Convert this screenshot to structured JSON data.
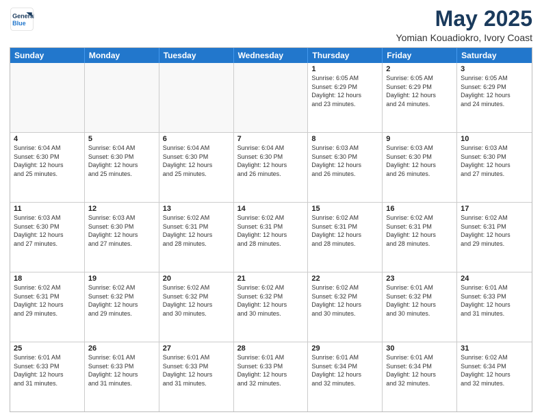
{
  "header": {
    "logo_line1": "General",
    "logo_line2": "Blue",
    "main_title": "May 2025",
    "subtitle": "Yomian Kouadiokro, Ivory Coast"
  },
  "day_headers": [
    "Sunday",
    "Monday",
    "Tuesday",
    "Wednesday",
    "Thursday",
    "Friday",
    "Saturday"
  ],
  "weeks": [
    [
      {
        "date": "",
        "info": ""
      },
      {
        "date": "",
        "info": ""
      },
      {
        "date": "",
        "info": ""
      },
      {
        "date": "",
        "info": ""
      },
      {
        "date": "1",
        "info": "Sunrise: 6:05 AM\nSunset: 6:29 PM\nDaylight: 12 hours\nand 23 minutes."
      },
      {
        "date": "2",
        "info": "Sunrise: 6:05 AM\nSunset: 6:29 PM\nDaylight: 12 hours\nand 24 minutes."
      },
      {
        "date": "3",
        "info": "Sunrise: 6:05 AM\nSunset: 6:29 PM\nDaylight: 12 hours\nand 24 minutes."
      }
    ],
    [
      {
        "date": "4",
        "info": "Sunrise: 6:04 AM\nSunset: 6:30 PM\nDaylight: 12 hours\nand 25 minutes."
      },
      {
        "date": "5",
        "info": "Sunrise: 6:04 AM\nSunset: 6:30 PM\nDaylight: 12 hours\nand 25 minutes."
      },
      {
        "date": "6",
        "info": "Sunrise: 6:04 AM\nSunset: 6:30 PM\nDaylight: 12 hours\nand 25 minutes."
      },
      {
        "date": "7",
        "info": "Sunrise: 6:04 AM\nSunset: 6:30 PM\nDaylight: 12 hours\nand 26 minutes."
      },
      {
        "date": "8",
        "info": "Sunrise: 6:03 AM\nSunset: 6:30 PM\nDaylight: 12 hours\nand 26 minutes."
      },
      {
        "date": "9",
        "info": "Sunrise: 6:03 AM\nSunset: 6:30 PM\nDaylight: 12 hours\nand 26 minutes."
      },
      {
        "date": "10",
        "info": "Sunrise: 6:03 AM\nSunset: 6:30 PM\nDaylight: 12 hours\nand 27 minutes."
      }
    ],
    [
      {
        "date": "11",
        "info": "Sunrise: 6:03 AM\nSunset: 6:30 PM\nDaylight: 12 hours\nand 27 minutes."
      },
      {
        "date": "12",
        "info": "Sunrise: 6:03 AM\nSunset: 6:30 PM\nDaylight: 12 hours\nand 27 minutes."
      },
      {
        "date": "13",
        "info": "Sunrise: 6:02 AM\nSunset: 6:31 PM\nDaylight: 12 hours\nand 28 minutes."
      },
      {
        "date": "14",
        "info": "Sunrise: 6:02 AM\nSunset: 6:31 PM\nDaylight: 12 hours\nand 28 minutes."
      },
      {
        "date": "15",
        "info": "Sunrise: 6:02 AM\nSunset: 6:31 PM\nDaylight: 12 hours\nand 28 minutes."
      },
      {
        "date": "16",
        "info": "Sunrise: 6:02 AM\nSunset: 6:31 PM\nDaylight: 12 hours\nand 28 minutes."
      },
      {
        "date": "17",
        "info": "Sunrise: 6:02 AM\nSunset: 6:31 PM\nDaylight: 12 hours\nand 29 minutes."
      }
    ],
    [
      {
        "date": "18",
        "info": "Sunrise: 6:02 AM\nSunset: 6:31 PM\nDaylight: 12 hours\nand 29 minutes."
      },
      {
        "date": "19",
        "info": "Sunrise: 6:02 AM\nSunset: 6:32 PM\nDaylight: 12 hours\nand 29 minutes."
      },
      {
        "date": "20",
        "info": "Sunrise: 6:02 AM\nSunset: 6:32 PM\nDaylight: 12 hours\nand 30 minutes."
      },
      {
        "date": "21",
        "info": "Sunrise: 6:02 AM\nSunset: 6:32 PM\nDaylight: 12 hours\nand 30 minutes."
      },
      {
        "date": "22",
        "info": "Sunrise: 6:02 AM\nSunset: 6:32 PM\nDaylight: 12 hours\nand 30 minutes."
      },
      {
        "date": "23",
        "info": "Sunrise: 6:01 AM\nSunset: 6:32 PM\nDaylight: 12 hours\nand 30 minutes."
      },
      {
        "date": "24",
        "info": "Sunrise: 6:01 AM\nSunset: 6:33 PM\nDaylight: 12 hours\nand 31 minutes."
      }
    ],
    [
      {
        "date": "25",
        "info": "Sunrise: 6:01 AM\nSunset: 6:33 PM\nDaylight: 12 hours\nand 31 minutes."
      },
      {
        "date": "26",
        "info": "Sunrise: 6:01 AM\nSunset: 6:33 PM\nDaylight: 12 hours\nand 31 minutes."
      },
      {
        "date": "27",
        "info": "Sunrise: 6:01 AM\nSunset: 6:33 PM\nDaylight: 12 hours\nand 31 minutes."
      },
      {
        "date": "28",
        "info": "Sunrise: 6:01 AM\nSunset: 6:33 PM\nDaylight: 12 hours\nand 32 minutes."
      },
      {
        "date": "29",
        "info": "Sunrise: 6:01 AM\nSunset: 6:34 PM\nDaylight: 12 hours\nand 32 minutes."
      },
      {
        "date": "30",
        "info": "Sunrise: 6:01 AM\nSunset: 6:34 PM\nDaylight: 12 hours\nand 32 minutes."
      },
      {
        "date": "31",
        "info": "Sunrise: 6:02 AM\nSunset: 6:34 PM\nDaylight: 12 hours\nand 32 minutes."
      }
    ]
  ]
}
